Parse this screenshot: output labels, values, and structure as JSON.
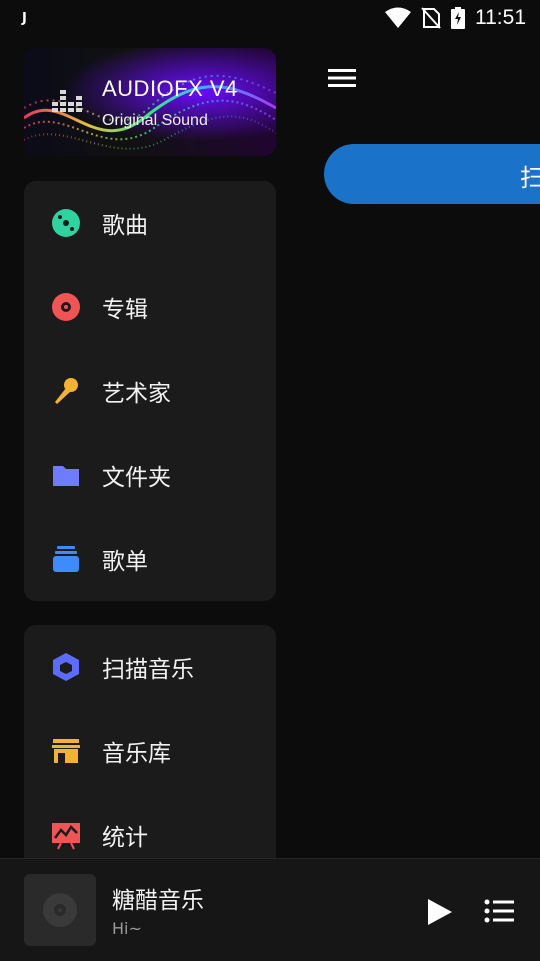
{
  "status_bar": {
    "left_indicator": "J",
    "time": "11:51"
  },
  "drawer": {
    "banner": {
      "title": "AUDIOFX V4",
      "subtitle": "Original Sound"
    },
    "library_items": [
      {
        "label": "歌曲",
        "icon": "song-disc-icon",
        "color": "#2ed3a0"
      },
      {
        "label": "专辑",
        "icon": "album-disc-icon",
        "color": "#f05454"
      },
      {
        "label": "艺术家",
        "icon": "microphone-icon",
        "color": "#f2b233"
      },
      {
        "label": "文件夹",
        "icon": "folder-icon",
        "color": "#6f7cff"
      },
      {
        "label": "歌单",
        "icon": "playlist-stack-icon",
        "color": "#3c8cff"
      }
    ],
    "tool_items": [
      {
        "label": "扫描音乐",
        "icon": "scan-cube-icon",
        "color": "#5b6cff"
      },
      {
        "label": "音乐库",
        "icon": "store-icon",
        "color": "#f2b233"
      },
      {
        "label": "统计",
        "icon": "stats-chart-icon",
        "color": "#f05454"
      }
    ]
  },
  "main": {
    "scan_button_label": "扫"
  },
  "player": {
    "title": "糖醋音乐",
    "subtitle": "Hi~"
  },
  "colors": {
    "accent": "#1a73c8",
    "background": "#0c0c0c",
    "card": "#1b1b1b"
  }
}
